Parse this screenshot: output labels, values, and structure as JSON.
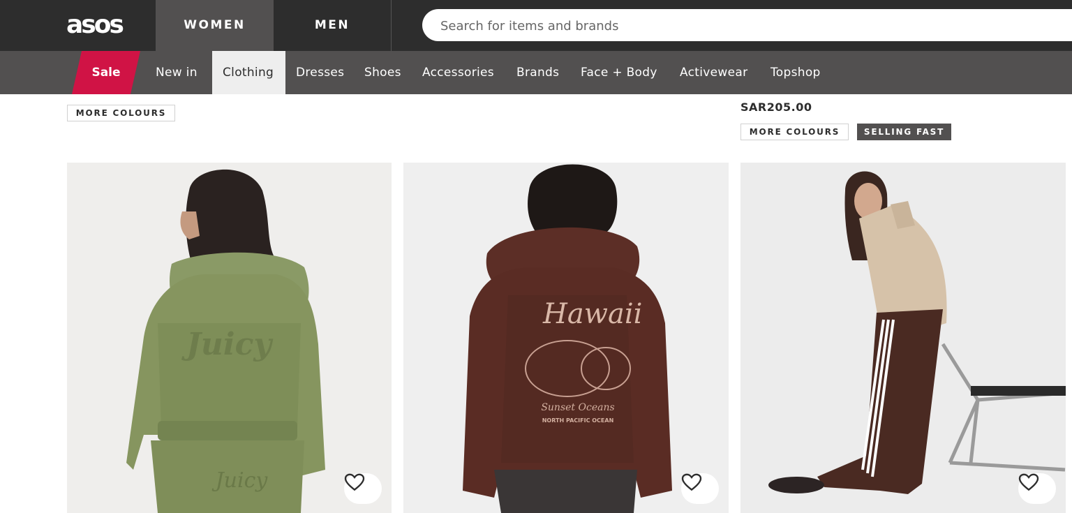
{
  "header": {
    "logo": "asos",
    "tabs": [
      "WOMEN",
      "MEN"
    ],
    "search_placeholder": "Search for items and brands"
  },
  "nav": {
    "sale": "Sale",
    "items": [
      "New in",
      "Clothing",
      "Dresses",
      "Shoes",
      "Accessories",
      "Brands",
      "Face + Body",
      "Activewear",
      "Topshop"
    ],
    "active": "Clothing"
  },
  "products_top": [
    {
      "badge": "MORE COLOURS"
    },
    {
      "price": "SAR205.00",
      "badge": "MORE COLOURS",
      "badge2": "SELLING FAST"
    }
  ],
  "cards": [
    {
      "image": "olive-hoodie-photo",
      "icon": "heart-icon"
    },
    {
      "image": "brown-hawaii-hoodie-photo",
      "icon": "heart-icon"
    },
    {
      "image": "beige-jacket-striped-trousers-photo",
      "icon": "heart-icon"
    }
  ],
  "colors": {
    "topbar": "#2d2d2d",
    "navbar": "#525050",
    "sale": "#d01345",
    "active_tab": "#eeeeee"
  }
}
